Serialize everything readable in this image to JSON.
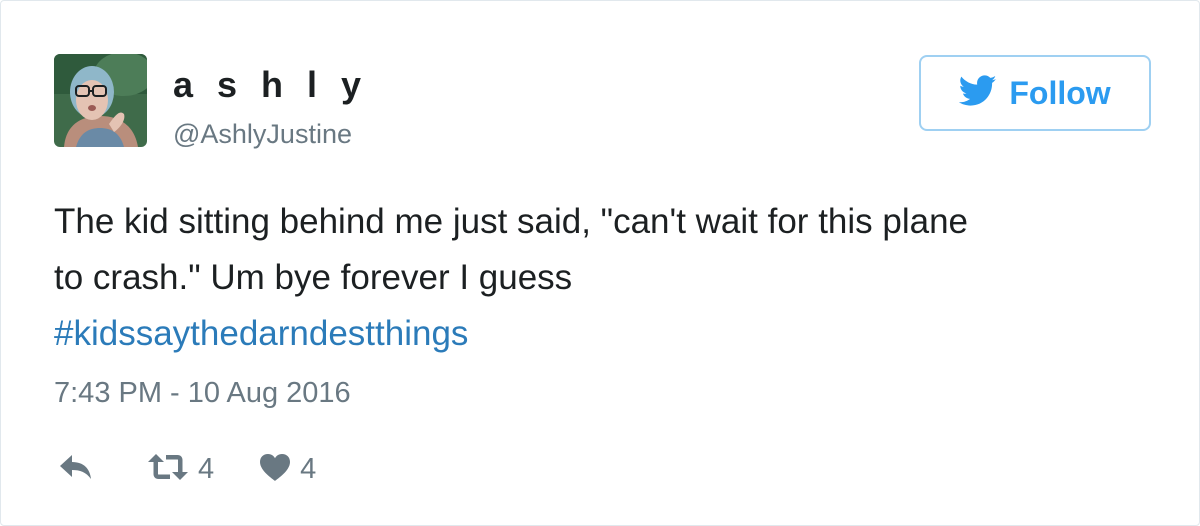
{
  "user": {
    "display_name": "a s h l y",
    "handle": "@AshlyJustine"
  },
  "follow_button": {
    "label": "Follow"
  },
  "tweet": {
    "text_line1": "The kid sitting behind me just said, \"can't wait for this plane",
    "text_line2": "to crash.\" Um bye forever I guess",
    "hashtag": "#kidssaythedarndestthings",
    "timestamp": "7:43 PM - 10 Aug 2016"
  },
  "actions": {
    "retweet_count": "4",
    "like_count": "4"
  },
  "colors": {
    "link": "#2b7bb9",
    "twitter_blue": "#2b9bf0",
    "secondary_text": "#697882",
    "action_icon": "#697882",
    "primary_text": "#1c2022"
  }
}
